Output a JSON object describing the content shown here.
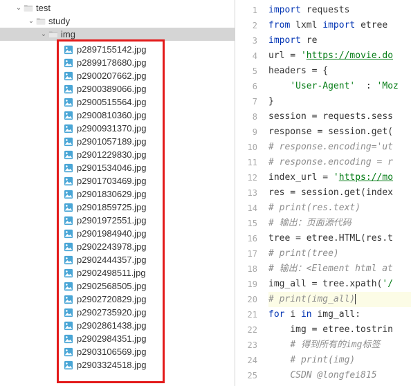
{
  "tree": {
    "folders": [
      {
        "name": "test",
        "indent": 22
      },
      {
        "name": "study",
        "indent": 40
      },
      {
        "name": "img",
        "indent": 58,
        "selected": true
      }
    ],
    "files": [
      "p2897155142.jpg",
      "p2899178680.jpg",
      "p2900207662.jpg",
      "p2900389066.jpg",
      "p2900515564.jpg",
      "p2900810360.jpg",
      "p2900931370.jpg",
      "p2901057189.jpg",
      "p2901229830.jpg",
      "p2901534046.jpg",
      "p2901703469.jpg",
      "p2901830629.jpg",
      "p2901859725.jpg",
      "p2901972551.jpg",
      "p2901984940.jpg",
      "p2902243978.jpg",
      "p2902444357.jpg",
      "p2902498511.jpg",
      "p2902568505.jpg",
      "p2902720829.jpg",
      "p2902735920.jpg",
      "p2902861438.jpg",
      "p2902984351.jpg",
      "p2903106569.jpg",
      "p2903324518.jpg"
    ]
  },
  "code": {
    "lines": [
      {
        "n": 1,
        "seg": [
          {
            "t": "import ",
            "c": "kw"
          },
          {
            "t": "requests"
          }
        ]
      },
      {
        "n": 2,
        "seg": [
          {
            "t": "from ",
            "c": "kw"
          },
          {
            "t": "lxml "
          },
          {
            "t": "import ",
            "c": "kw"
          },
          {
            "t": "etree"
          }
        ]
      },
      {
        "n": 3,
        "seg": [
          {
            "t": "import ",
            "c": "kw"
          },
          {
            "t": "re"
          }
        ]
      },
      {
        "n": 4,
        "seg": [
          {
            "t": "url = "
          },
          {
            "t": "'",
            "c": "str"
          },
          {
            "t": "https://movie.do",
            "c": "strlink"
          }
        ]
      },
      {
        "n": 5,
        "seg": [
          {
            "t": "headers = {"
          }
        ]
      },
      {
        "n": 6,
        "seg": [
          {
            "t": "    "
          },
          {
            "t": "'User-Agent'",
            "c": "str"
          },
          {
            "t": "  : "
          },
          {
            "t": "'Moz",
            "c": "str"
          }
        ]
      },
      {
        "n": 7,
        "seg": [
          {
            "t": "}"
          }
        ]
      },
      {
        "n": 8,
        "seg": [
          {
            "t": "session = requests.sess"
          }
        ]
      },
      {
        "n": 9,
        "seg": [
          {
            "t": "response = session.get("
          }
        ]
      },
      {
        "n": 10,
        "seg": [
          {
            "t": "# response.encoding='ut",
            "c": "cmt"
          }
        ]
      },
      {
        "n": 11,
        "seg": [
          {
            "t": "# response.encoding = r",
            "c": "cmt"
          }
        ]
      },
      {
        "n": 12,
        "seg": [
          {
            "t": "index_url = "
          },
          {
            "t": "'",
            "c": "str"
          },
          {
            "t": "https://mo",
            "c": "strlink"
          }
        ]
      },
      {
        "n": 13,
        "seg": [
          {
            "t": "res = session.get(index"
          }
        ]
      },
      {
        "n": 14,
        "seg": [
          {
            "t": "# print(res.text)",
            "c": "cmt"
          }
        ]
      },
      {
        "n": 15,
        "seg": [
          {
            "t": "# 输出：页面源代码",
            "c": "cmt"
          }
        ]
      },
      {
        "n": 16,
        "seg": [
          {
            "t": "tree = etree.HTML(res.t"
          }
        ]
      },
      {
        "n": 17,
        "seg": [
          {
            "t": "# print(tree)",
            "c": "cmt"
          }
        ]
      },
      {
        "n": 18,
        "seg": [
          {
            "t": "# 输出：<Element html at",
            "c": "cmt"
          }
        ]
      },
      {
        "n": 19,
        "seg": [
          {
            "t": "img_all = tree.xpath("
          },
          {
            "t": "'/",
            "c": "str"
          }
        ]
      },
      {
        "n": 20,
        "hl": true,
        "seg": [
          {
            "t": "# print(img_all)",
            "c": "cmt"
          },
          {
            "cursor": true
          }
        ]
      },
      {
        "n": 21,
        "seg": [
          {
            "t": "for ",
            "c": "kw"
          },
          {
            "t": "i "
          },
          {
            "t": "in ",
            "c": "kw"
          },
          {
            "t": "img_all:"
          }
        ]
      },
      {
        "n": 22,
        "seg": [
          {
            "t": "    img = etree.tostrin"
          }
        ]
      },
      {
        "n": 23,
        "seg": [
          {
            "t": "    "
          },
          {
            "t": "# 得到所有的img标签",
            "c": "cmt"
          }
        ]
      },
      {
        "n": 24,
        "seg": [
          {
            "t": "    "
          },
          {
            "t": "# print(img)",
            "c": "cmt"
          }
        ]
      },
      {
        "n": 25,
        "seg": [
          {
            "t": "    "
          },
          {
            "t": "CSDN @longfei815",
            "c": "cmt"
          }
        ]
      }
    ]
  },
  "watermark": "CSDN @longfei815"
}
